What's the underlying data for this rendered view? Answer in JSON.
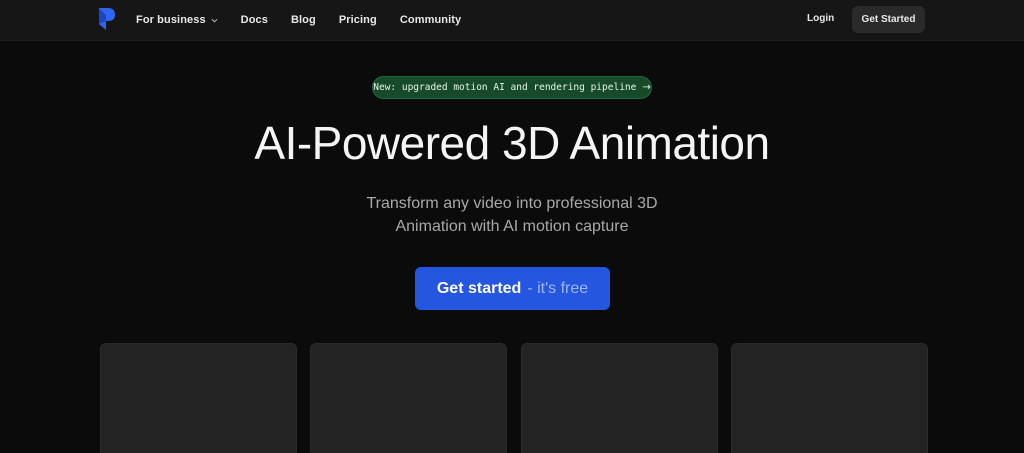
{
  "nav": {
    "links": [
      {
        "label": "For business",
        "has_dropdown": true
      },
      {
        "label": "Docs"
      },
      {
        "label": "Blog"
      },
      {
        "label": "Pricing"
      },
      {
        "label": "Community"
      }
    ],
    "login_label": "Login",
    "get_started_label": "Get Started",
    "logo_icon": "brand-logo-icon"
  },
  "announcement": {
    "text": "New: upgraded motion AI and rendering pipeline",
    "arrow": "→"
  },
  "hero": {
    "title": "AI-Powered 3D Animation",
    "subtitle_line1": "Transform any video into professional 3D",
    "subtitle_line2": "Animation with AI motion capture",
    "cta_main": "Get started",
    "cta_suffix": "- it's free"
  },
  "colors": {
    "accent": "#2456e0",
    "pill_bg": "#174a2a",
    "background": "#0b0b0b",
    "nav_bg": "#161616",
    "card_bg": "#232323"
  }
}
